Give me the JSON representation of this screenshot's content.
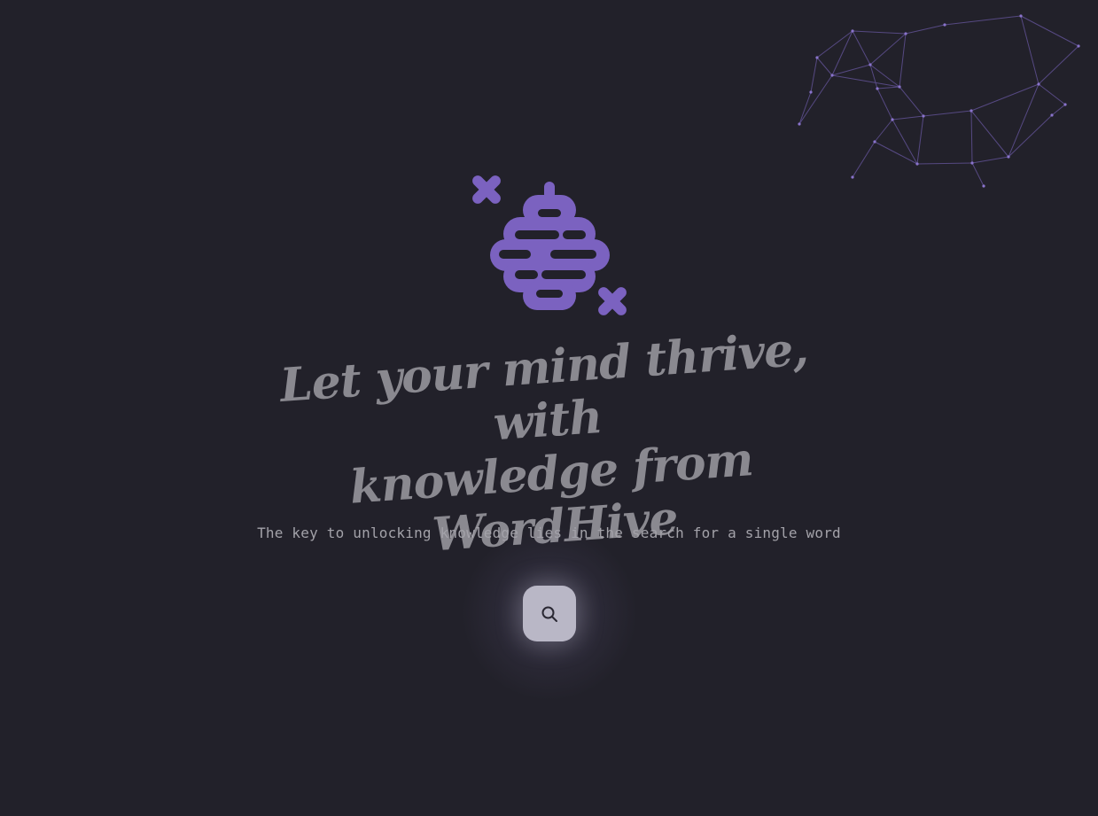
{
  "brand": {
    "logo_icon": "honeycomb-bee-logo-icon",
    "accent_color": "#7b62c0"
  },
  "hero": {
    "headline_line1": "Let your mind thrive, with",
    "headline_line2": "knowledge from WordHive",
    "subtitle": "The key to unlocking knowledge lies in the search for a single word"
  },
  "actions": {
    "search_icon": "search-icon",
    "search_button_color": "#b9b7c6"
  },
  "decoration": {
    "network_icon": "constellation-network-graphic",
    "network_color": "#6c5aa8"
  }
}
